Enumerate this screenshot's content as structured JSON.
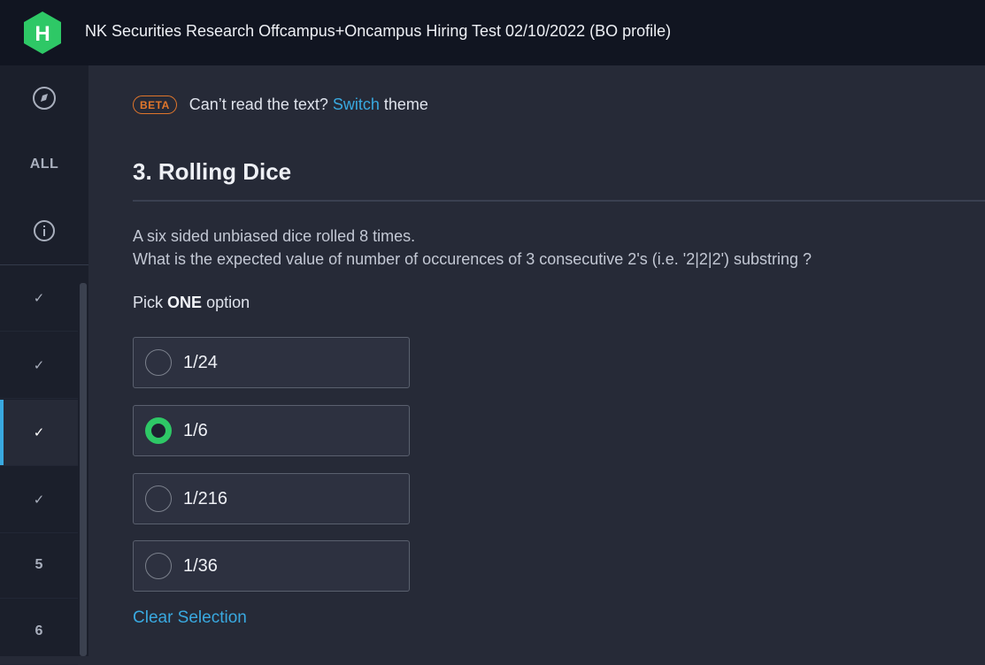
{
  "header": {
    "logo_letter": "H",
    "test_title": "NK Securities Research Offcampus+Oncampus Hiring Test 02/10/2022 (BO profile)"
  },
  "sidebar": {
    "all_label": "ALL",
    "questions": [
      {
        "label": "✓",
        "state": "answered"
      },
      {
        "label": "✓",
        "state": "answered"
      },
      {
        "label": "✓",
        "state": "answered-current"
      },
      {
        "label": "✓",
        "state": "answered"
      },
      {
        "label": "5",
        "state": "unanswered"
      },
      {
        "label": "6",
        "state": "unanswered"
      }
    ]
  },
  "notice": {
    "badge": "BETA",
    "text_before": "Can’t read the text?",
    "link": "Switch",
    "text_after": "theme"
  },
  "question": {
    "title": "3. Rolling Dice",
    "line1": "A six sided unbiased dice rolled 8 times.",
    "line2": "What is the expected value of number of occurences of 3 consecutive 2's (i.e. '2|2|2') substring ?",
    "pick_prefix": "Pick",
    "pick_bold": "ONE",
    "pick_suffix": "option",
    "options": [
      {
        "label": "1/24",
        "selected": false
      },
      {
        "label": "1/6",
        "selected": true
      },
      {
        "label": "1/216",
        "selected": false
      },
      {
        "label": "1/36",
        "selected": false
      }
    ],
    "clear_label": "Clear Selection"
  },
  "colors": {
    "accent": "#39a9e0",
    "selected_radio": "#2ec866",
    "beta": "#e0762b",
    "logo": "#2ec866"
  }
}
